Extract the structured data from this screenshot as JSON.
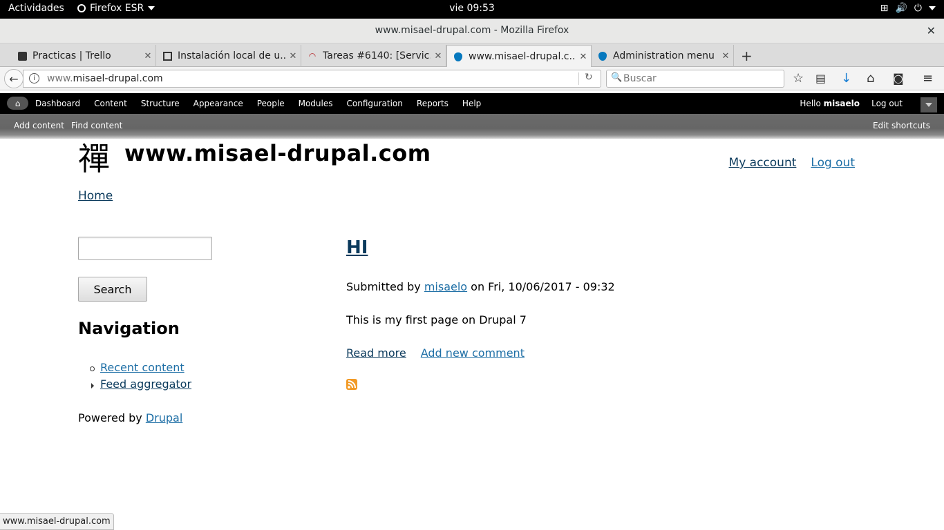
{
  "system": {
    "activities": "Actividades",
    "app_name": "Firefox ESR",
    "clock": "vie 09:53"
  },
  "window": {
    "title": "www.misael-drupal.com - Mozilla Firefox"
  },
  "tabs": [
    {
      "label": "Practicas | Trello",
      "icon": "trello-icon"
    },
    {
      "label": "Instalación local de u...",
      "icon": "document-icon"
    },
    {
      "label": "Tareas #6140: [Servic...",
      "icon": "redmine-icon"
    },
    {
      "label": "www.misael-drupal.c...",
      "icon": "drupal-icon",
      "active": true
    },
    {
      "label": "Administration menu |...",
      "icon": "drupal-icon"
    }
  ],
  "navbar": {
    "url_dim": "www.",
    "url_host": "misael-drupal.com",
    "search_placeholder": "Buscar"
  },
  "admin_toolbar": {
    "menu": [
      "Dashboard",
      "Content",
      "Structure",
      "Appearance",
      "People",
      "Modules",
      "Configuration",
      "Reports",
      "Help"
    ],
    "hello": "Hello ",
    "username": "misaelo",
    "logout": "Log out",
    "shortcuts": [
      "Add content",
      "Find content"
    ],
    "edit_shortcuts": "Edit shortcuts"
  },
  "site": {
    "logo_glyph": "禪",
    "name": "www.misael-drupal.com",
    "my_account": "My account",
    "log_out": "Log out",
    "breadcrumb": "Home"
  },
  "sidebar": {
    "search_button": "Search",
    "nav_title": "Navigation",
    "nav_items": [
      "Recent content",
      "Feed aggregator"
    ],
    "powered_by": "Powered by ",
    "powered_link": "Drupal"
  },
  "node": {
    "title": "HI",
    "submitted_prefix": "Submitted by ",
    "author": "misaelo",
    "submitted_suffix": " on Fri, 10/06/2017 - 09:32",
    "body": "This is my first page on Drupal 7",
    "read_more": "Read more",
    "add_comment": "Add new comment"
  },
  "status_bar": "www.misael-drupal.com",
  "colors": {
    "link_blue": "#1e6fa6",
    "link_dark": "#0b3a5c",
    "rss_orange": "#f29a26",
    "toolbar_black": "#000000"
  }
}
